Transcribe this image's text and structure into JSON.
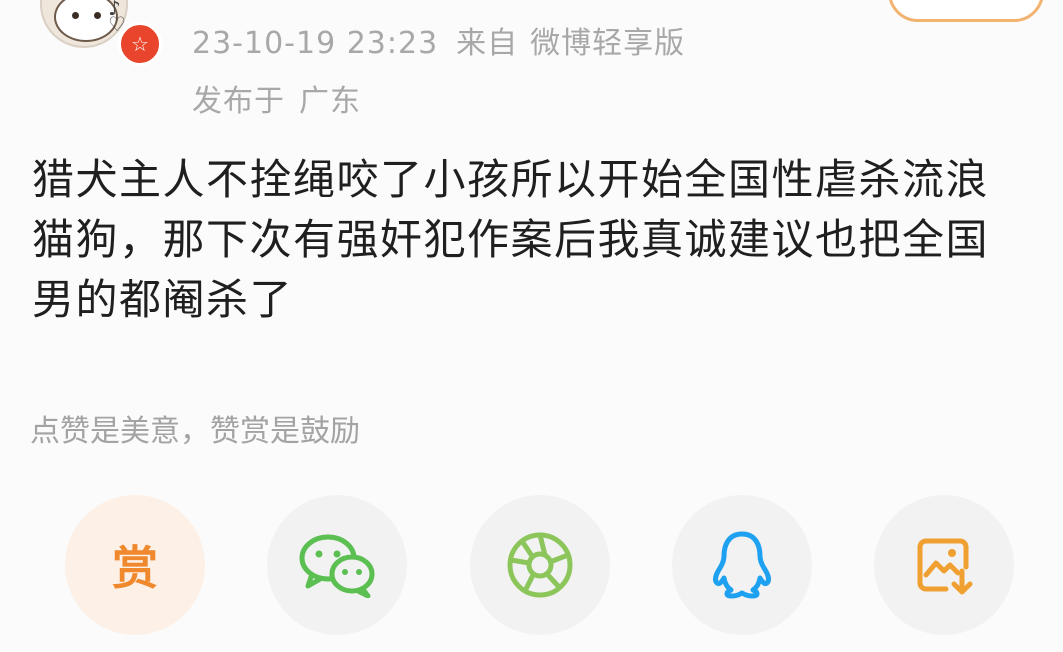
{
  "post": {
    "datetime": "23-10-19 23:23",
    "source_prefix": "来自",
    "source": "微博轻享版",
    "location_prefix": "发布于",
    "location": "广东",
    "text": "猎犬主人不拴绳咬了小孩所以开始全国性虐杀流浪猫狗，那下次有强奸犯作案后我真诚建议也把全国男的都阉杀了"
  },
  "reward": {
    "tip": "点赞是美意，赞赏是鼓励",
    "label": "赏"
  },
  "share": {
    "items": [
      {
        "icon": "wechat-icon",
        "color": "#5bbf52"
      },
      {
        "icon": "moments-icon",
        "color": "#8cc65b"
      },
      {
        "icon": "qq-icon",
        "color": "#1ea1f1"
      },
      {
        "icon": "save-image-icon",
        "color": "#f0a030"
      }
    ]
  },
  "colors": {
    "accent": "#f0892d",
    "badge": "#e8452c",
    "meta_text": "#a8a8a8",
    "body_text": "#1f1f1f"
  }
}
